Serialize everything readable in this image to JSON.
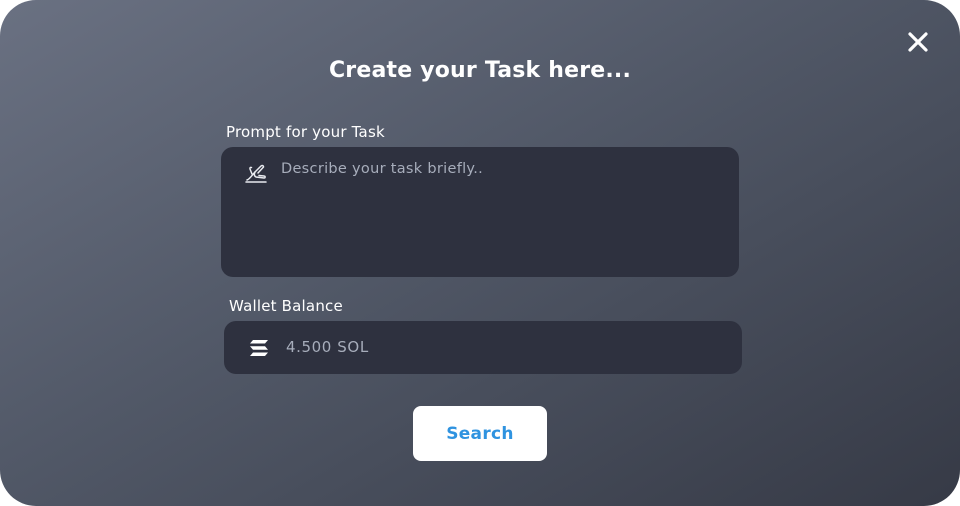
{
  "modal": {
    "title": "Create your Task here...",
    "close_icon": "close-icon",
    "prompt": {
      "label": "Prompt for your Task",
      "placeholder": "Describe your task briefly..",
      "value": "",
      "icon": "writing-hand-icon"
    },
    "wallet": {
      "label": "Wallet Balance",
      "value": "4.500 SOL",
      "icon": "solana-icon"
    },
    "search_button": {
      "label": "Search"
    }
  },
  "colors": {
    "background_top": "#6a7182",
    "background_bottom": "#363a46",
    "field_background": "#2e313f",
    "button_background": "#ffffff",
    "button_text": "#2f93e0"
  }
}
